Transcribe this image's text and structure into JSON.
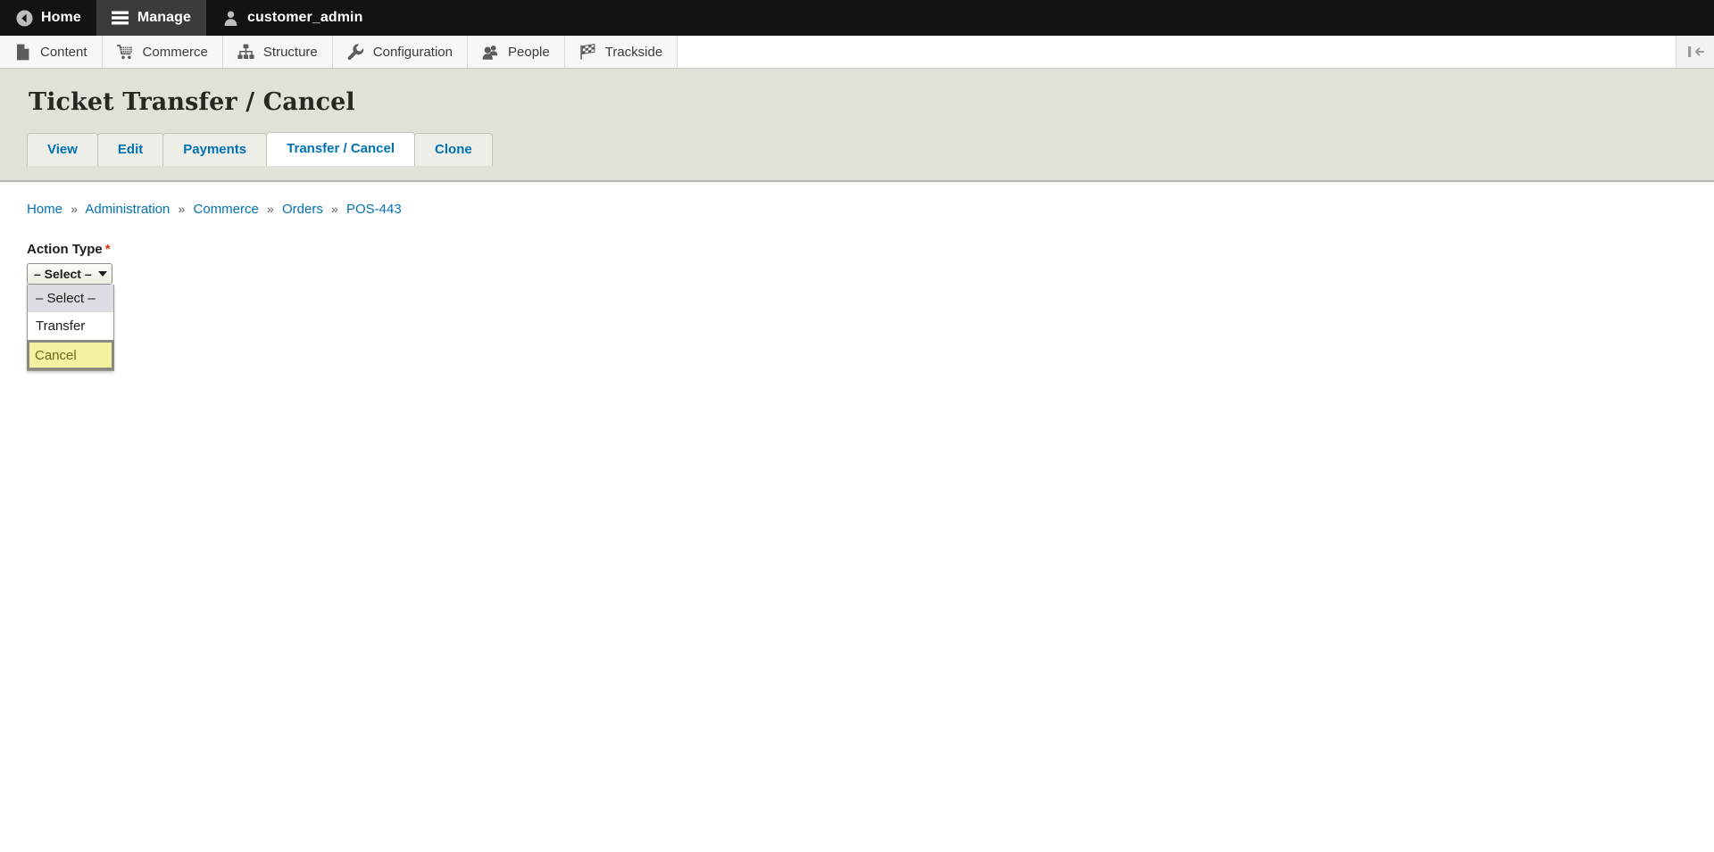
{
  "toolbar": {
    "tabs": [
      {
        "label": "Home",
        "icon": "back-arrow-icon",
        "active": false
      },
      {
        "label": "Manage",
        "icon": "hamburger-icon",
        "active": true
      },
      {
        "label": "customer_admin",
        "icon": "user-icon",
        "active": false
      }
    ]
  },
  "menu": {
    "items": [
      {
        "label": "Content",
        "icon": "document-icon"
      },
      {
        "label": "Commerce",
        "icon": "shopping-cart-icon"
      },
      {
        "label": "Structure",
        "icon": "hierarchy-icon"
      },
      {
        "label": "Configuration",
        "icon": "wrench-icon"
      },
      {
        "label": "People",
        "icon": "people-icon"
      },
      {
        "label": "Trackside",
        "icon": "checkered-flag-icon"
      }
    ],
    "collapse_icon": "collapse-toolbar-icon"
  },
  "page": {
    "title": "Ticket Transfer / Cancel"
  },
  "tabs": [
    {
      "label": "View",
      "active": false
    },
    {
      "label": "Edit",
      "active": false
    },
    {
      "label": "Payments",
      "active": false
    },
    {
      "label": "Transfer / Cancel",
      "active": true
    },
    {
      "label": "Clone",
      "active": false
    }
  ],
  "breadcrumb": {
    "separator": "»",
    "items": [
      "Home",
      "Administration",
      "Commerce",
      "Orders",
      "POS-443"
    ]
  },
  "form": {
    "action_type": {
      "label": "Action Type",
      "required_marker": "*",
      "selected_value": "– Select –",
      "expanded": true,
      "options": [
        {
          "label": "– Select –",
          "state": "current"
        },
        {
          "label": "Transfer",
          "state": "plain"
        },
        {
          "label": "Cancel",
          "state": "highlighted"
        }
      ]
    }
  },
  "colors": {
    "toolbar_bg": "#131313",
    "toolbar_active": "#3b3b3b",
    "menu_bg": "#f7f7f5",
    "header_band": "#e1e1d9",
    "link_blue": "#0071b3",
    "required_red": "#e32d0f",
    "highlight_yellow": "#f2f2a0",
    "content_bg": "#ffffff"
  }
}
